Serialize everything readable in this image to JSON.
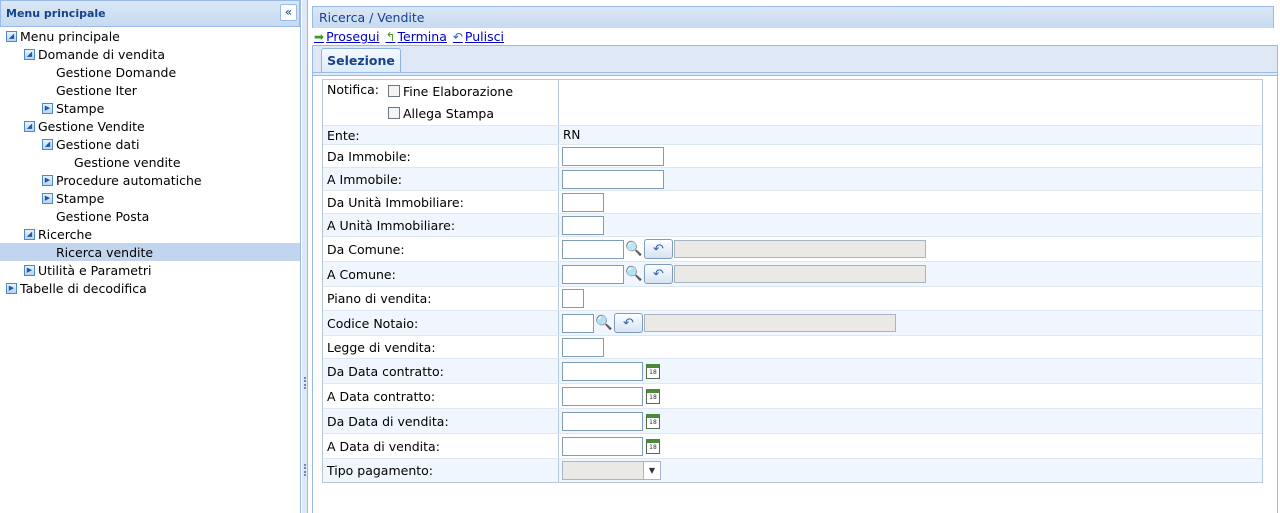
{
  "menu": {
    "title": "Menu principale",
    "collapse_glyph": "«",
    "items": [
      {
        "label": "Menu principale",
        "level": 0,
        "icon": "expanded"
      },
      {
        "label": "Domande di vendita",
        "level": 1,
        "icon": "expanded"
      },
      {
        "label": "Gestione Domande",
        "level": 2,
        "icon": "none"
      },
      {
        "label": "Gestione Iter",
        "level": 2,
        "icon": "none"
      },
      {
        "label": "Stampe",
        "level": 2,
        "icon": "collapsed"
      },
      {
        "label": "Gestione Vendite",
        "level": 1,
        "icon": "expanded"
      },
      {
        "label": "Gestione dati",
        "level": 2,
        "icon": "expanded"
      },
      {
        "label": "Gestione vendite",
        "level": 3,
        "icon": "none"
      },
      {
        "label": "Procedure automatiche",
        "level": 2,
        "icon": "collapsed"
      },
      {
        "label": "Stampe",
        "level": 2,
        "icon": "collapsed"
      },
      {
        "label": "Gestione Posta",
        "level": 2,
        "icon": "none"
      },
      {
        "label": "Ricerche",
        "level": 1,
        "icon": "expanded"
      },
      {
        "label": "Ricerca vendite",
        "level": 2,
        "icon": "none",
        "selected": true
      },
      {
        "label": "Utilità e Parametri",
        "level": 1,
        "icon": "collapsed"
      },
      {
        "label": "Tabelle di decodifica",
        "level": 0,
        "icon": "collapsed"
      }
    ]
  },
  "panel": {
    "title": "Ricerca / Vendite",
    "toolbar": {
      "prosegui": "Prosegui",
      "termina": "Termina",
      "pulisci": "Pulisci"
    },
    "tab": "Selezione"
  },
  "form": {
    "notifica_label": "Notifica:",
    "fine_elaborazione": "Fine Elaborazione",
    "allega_stampa": "Allega Stampa",
    "ente_label": "Ente:",
    "ente_value": "RN",
    "da_immobile": "Da Immobile:",
    "a_immobile": "A Immobile:",
    "da_unita": "Da Unità Immobiliare:",
    "a_unita": "A Unità Immobiliare:",
    "da_comune": "Da Comune:",
    "a_comune": "A Comune:",
    "piano_vendita": "Piano di vendita:",
    "codice_notaio": "Codice Notaio:",
    "legge_vendita": "Legge di vendita:",
    "da_data_contratto": "Da Data contratto:",
    "a_data_contratto": "A Data contratto:",
    "da_data_vendita": "Da Data di vendita:",
    "a_data_vendita": "A Data di vendita:",
    "tipo_pagamento": "Tipo pagamento:",
    "calendar_glyph": "18"
  },
  "colors": {
    "header_text": "#15428b",
    "link": "#0000cc",
    "selected_row": "#c3d4ee"
  }
}
